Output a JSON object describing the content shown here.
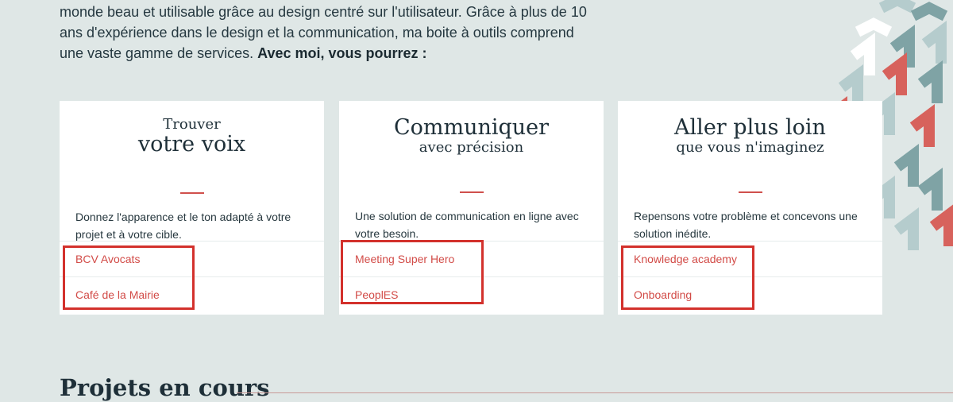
{
  "intro": {
    "line1": "monde beau et utilisable grâce au design centré sur l'utilisateur. Grâce à plus de 10",
    "line2": "ans d'expérience dans le design et la communication, ma boite à outils comprend",
    "line3": "une vaste gamme de services.",
    "bold": "Avec moi, vous pourrez :"
  },
  "cards": [
    {
      "title_top": "Trouver",
      "title_bottom": "votre voix",
      "description": "Donnez l'apparence et le ton adapté à votre projet et à votre cible.",
      "links": [
        "BCV Avocats",
        "Café de la Mairie"
      ]
    },
    {
      "title_top": "Communiquer",
      "title_bottom": "avec précision",
      "description": "Une solution de communication en ligne avec votre besoin.",
      "links": [
        "Meeting Super Hero",
        "PeoplES"
      ]
    },
    {
      "title_top": "Aller plus loin",
      "title_bottom": "que vous n'imaginez",
      "description": "Repensons votre problème et concevons une solution inédite.",
      "links": [
        "Knowledge academy",
        "Onboarding"
      ]
    }
  ],
  "section": {
    "title": "Projets en cours"
  },
  "colors": {
    "background": "#dfe7e6",
    "card": "#ffffff",
    "accent": "#d0504c",
    "link": "#d24b47",
    "highlight": "#d3312c",
    "pattern_teal": "#7fa3a5",
    "pattern_light": "#b5cccd",
    "pattern_red": "#d7625c"
  }
}
